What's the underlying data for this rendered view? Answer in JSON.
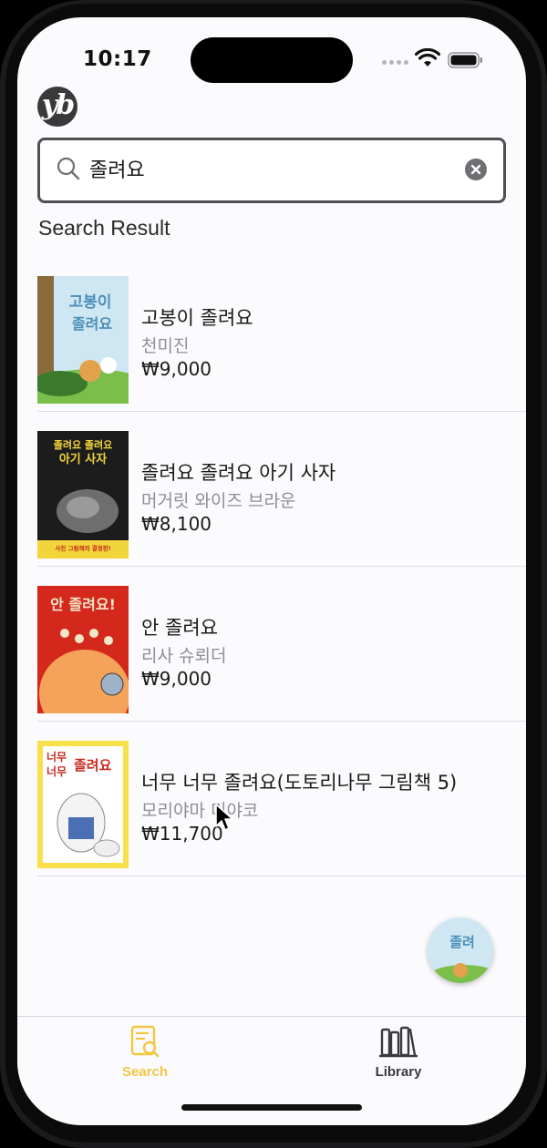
{
  "status_bar": {
    "time": "10:17"
  },
  "app": {
    "logo_text": "yb"
  },
  "search": {
    "query": "졸려요",
    "section_title": "Search Result"
  },
  "results": [
    {
      "title": "고봉이 졸려요",
      "author": "천미진",
      "price": "₩9,000",
      "cover_text": "고봉이 졸려요",
      "cover_palette": [
        "#cfe7f2",
        "#7bbf4a",
        "#3b7a2a"
      ]
    },
    {
      "title": "졸려요 졸려요 아기 사자",
      "author": "머거릿 와이즈 브라운",
      "price": "₩8,100",
      "cover_text": "졸려요 졸려요 아기 사자",
      "cover_badge": "사진 그림책의 결정판!",
      "cover_palette": [
        "#1c1c1c",
        "#f2d53a",
        "#8a8a8a"
      ]
    },
    {
      "title": "안 졸려요",
      "author": "리사 슈뢰더",
      "price": "₩9,000",
      "cover_text": "안 졸려요!",
      "cover_palette": [
        "#d4281c",
        "#f5a25a",
        "#f0e6c8"
      ]
    },
    {
      "title": "너무 너무 졸려요(도토리나무 그림책 5)",
      "author": "모리야마 미야코",
      "price": "₩11,700",
      "cover_text": "너무 너무 졸려요",
      "cover_palette": [
        "#f7e04a",
        "#ffffff",
        "#c52a1e"
      ]
    }
  ],
  "tabs": [
    {
      "label": "Search",
      "icon": "search-book-icon",
      "active": true
    },
    {
      "label": "Library",
      "icon": "library-icon",
      "active": false
    }
  ],
  "colors": {
    "accent": "#f2c744",
    "inactive_tab": "#3a3a3c",
    "secondary_text": "#8e8e93"
  }
}
